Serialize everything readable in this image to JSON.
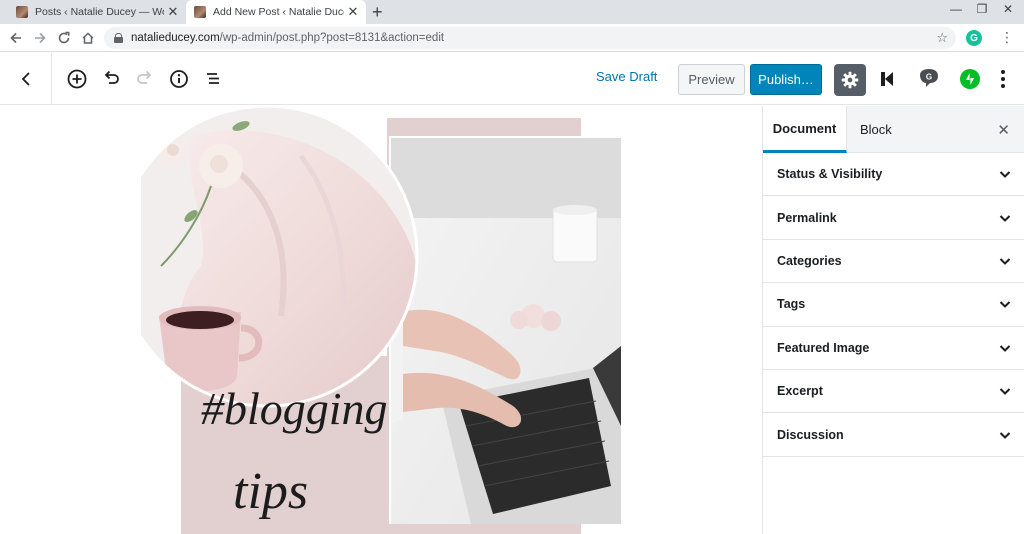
{
  "browser": {
    "tabs": [
      {
        "title": "Posts ‹ Natalie Ducey — WordPr",
        "active": false
      },
      {
        "title": "Add New Post ‹ Natalie Ducey —",
        "active": true
      }
    ],
    "new_tab": "+",
    "close_glyph": "✕",
    "url_host": "natalieducey.com",
    "url_path": "/wp-admin/post.php?post=8131&action=edit",
    "grammarly_letter": "G"
  },
  "editor_header": {
    "save_draft": "Save Draft",
    "preview": "Preview",
    "publish": "Publish…",
    "icons": [
      "back-icon",
      "add-block-icon",
      "undo-icon",
      "redo-icon",
      "info-icon",
      "outline-icon",
      "gear-icon",
      "kadence-icon",
      "grammarly-icon",
      "jetpack-icon",
      "more-icon"
    ]
  },
  "canvas": {
    "hashtag_text": "#blogging",
    "tips_text": "tips",
    "colors": {
      "blush": "#e2cfcf",
      "mug": "#e9c7c8",
      "tea": "#3d1f22"
    }
  },
  "sidebar": {
    "tab_document": "Document",
    "tab_block": "Block",
    "close": "✕",
    "panels": [
      "Status & Visibility",
      "Permalink",
      "Categories",
      "Tags",
      "Featured Image",
      "Excerpt",
      "Discussion"
    ]
  },
  "colors": {
    "wp_blue": "#0073aa",
    "publish_blue": "#0085ba",
    "settings_dark": "#555d66",
    "jetpack_green": "#00be28"
  }
}
